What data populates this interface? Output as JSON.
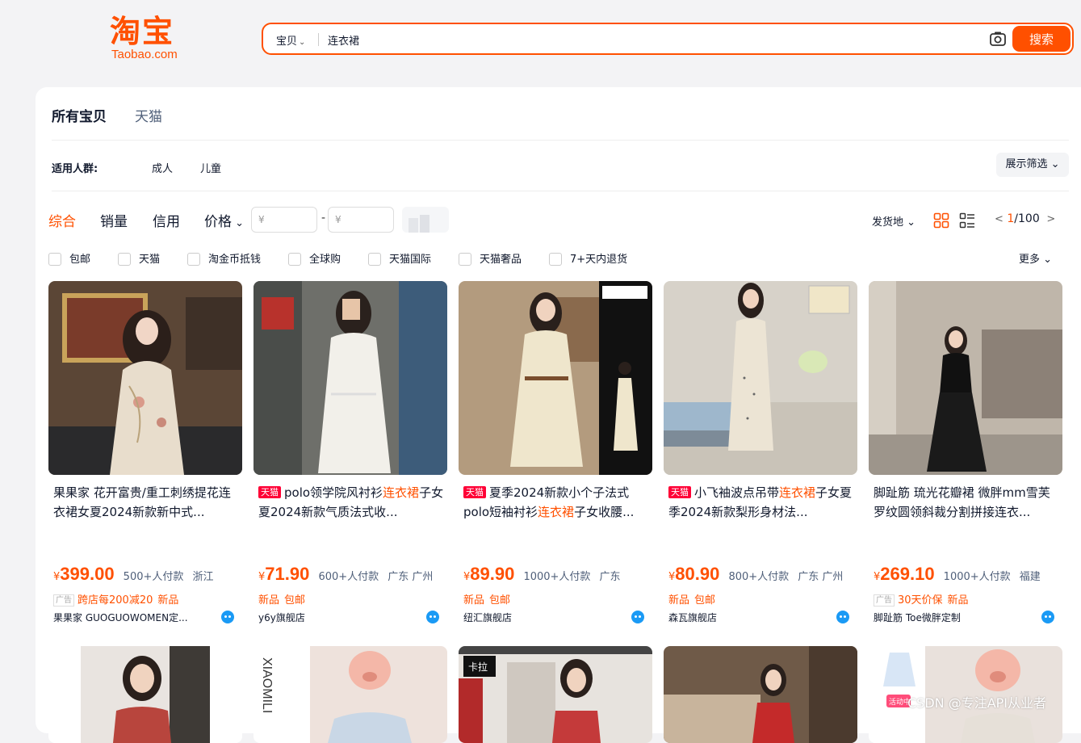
{
  "header": {
    "logo_cn": "淘宝",
    "logo_en": "Taobao.com",
    "search_type": "宝贝",
    "search_value": "连衣裙",
    "search_button": "搜索",
    "brand_color": "#ff5000"
  },
  "tabs": [
    "所有宝贝",
    "天猫"
  ],
  "filter": {
    "label": "适用人群:",
    "options": [
      "成人",
      "儿童"
    ],
    "show_filter": "展示筛选"
  },
  "sort": {
    "items": [
      "综合",
      "销量",
      "信用",
      "价格"
    ],
    "active": "综合",
    "price_min_placeholder": "¥",
    "price_max_placeholder": "¥",
    "ship_from": "发货地",
    "page_current": "1",
    "page_total": "/100"
  },
  "checkboxes": [
    "包邮",
    "天猫",
    "淘金币抵钱",
    "全球购",
    "天猫国际",
    "天猫奢品",
    "7+天内退货"
  ],
  "more": "更多",
  "products": [
    {
      "tmall": false,
      "title_before": "果果家 花开富贵/重工刺绣提花连衣裙女夏2024新款新中式...",
      "title_highlight": "",
      "title_after": "",
      "price": "399.00",
      "sold": "500+人付款",
      "location": "浙江",
      "ad": true,
      "tags": [
        "跨店每200减20",
        "新品"
      ],
      "shop": "果果家 GUOGUOWOMEN定..."
    },
    {
      "tmall": true,
      "title_before": "polo领学院风衬衫",
      "title_highlight": "连衣裙",
      "title_after": "子女夏2024新款气质法式收...",
      "price": "71.90",
      "sold": "600+人付款",
      "location": "广东 广州",
      "ad": false,
      "tags": [
        "新品",
        "包邮"
      ],
      "shop": "y6y旗舰店"
    },
    {
      "tmall": true,
      "title_before": "夏季2024新款小个子法式polo短袖衬衫",
      "title_highlight": "连衣裙",
      "title_after": "子女收腰...",
      "price": "89.90",
      "sold": "1000+人付款",
      "location": "广东",
      "ad": false,
      "tags": [
        "新品",
        "包邮"
      ],
      "shop": "纽汇旗舰店"
    },
    {
      "tmall": true,
      "title_before": "小飞袖波点吊带",
      "title_highlight": "连衣裙",
      "title_after": "子女夏季2024新款梨形身材法...",
      "price": "80.90",
      "sold": "800+人付款",
      "location": "广东 广州",
      "ad": false,
      "tags": [
        "新品",
        "包邮"
      ],
      "shop": "森瓦旗舰店"
    },
    {
      "tmall": false,
      "title_before": "脚趾筋 琉光花瓣裙 微胖mm雪芙罗纹圆领斜裁分割拼接连衣...",
      "title_highlight": "",
      "title_after": "",
      "price": "269.10",
      "sold": "1000+人付款",
      "location": "福建",
      "ad": true,
      "tags": [
        "30天价保",
        "新品"
      ],
      "shop": "脚趾筋 Toe微胖定制"
    }
  ],
  "common": {
    "tmall_tag": "天猫",
    "ad_tag": "广告",
    "currency": "¥"
  },
  "row2": {
    "side_text": "XIAOMILI",
    "brand_badge": "卡拉",
    "activity_badge": "活动中"
  },
  "watermark": "CSDN @专注API从业者"
}
